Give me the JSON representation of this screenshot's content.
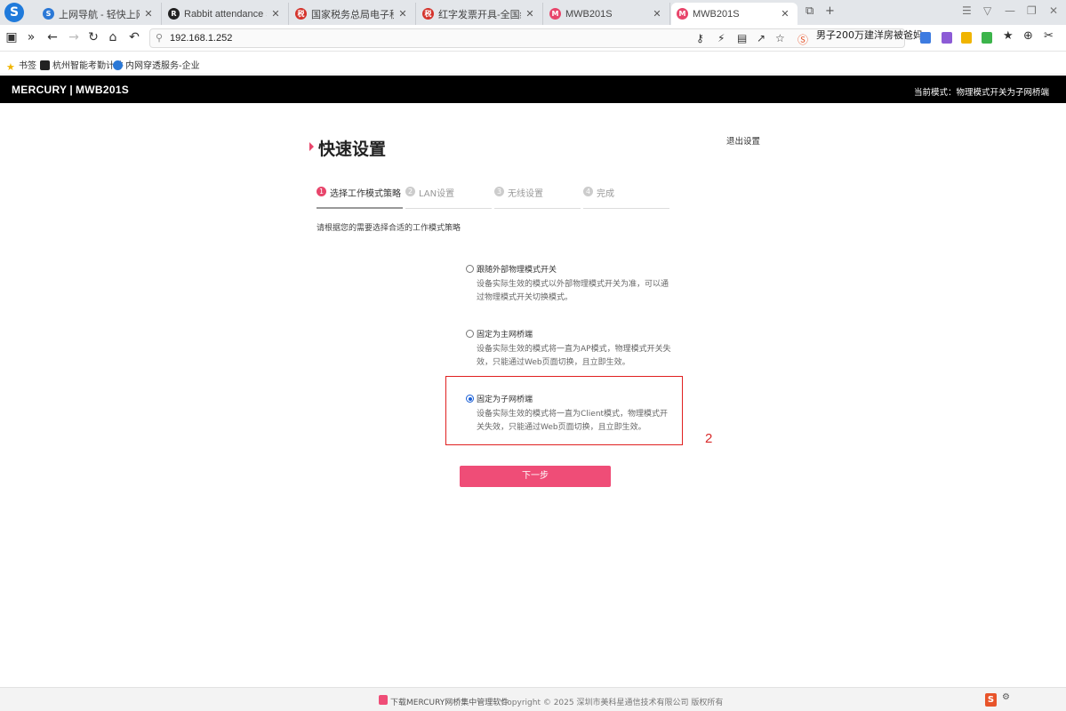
{
  "browser": {
    "tabs": [
      {
        "title": "上网导航 - 轻快上网 从这里开始",
        "favicon": "s-circle-icon",
        "color": "#2b78d6",
        "active": false
      },
      {
        "title": "Rabbit attendance software",
        "favicon": "rabbit-icon",
        "color": "#222222",
        "active": false
      },
      {
        "title": "国家税务总局电子税务局",
        "favicon": "tax-emblem-icon",
        "color": "#d4322b",
        "active": false
      },
      {
        "title": "红字发票开具-全国统一规范电子税务局",
        "favicon": "tax-emblem-icon",
        "color": "#d4322b",
        "active": false
      },
      {
        "title": "MWB201S",
        "favicon": "mercury-m-icon",
        "color": "#e8456b",
        "active": false
      },
      {
        "title": "MWB201S",
        "favicon": "mercury-m-icon",
        "color": "#e8456b",
        "active": true
      }
    ],
    "url": "192.168.1.252",
    "hot_search": "男子200万建洋房被爸妈",
    "bookmarks": [
      {
        "label": "书签",
        "icon": "star-icon"
      },
      {
        "label": "杭州智能考勤计件",
        "icon": "rabbit-icon"
      },
      {
        "label": "内网穿透服务-企业",
        "icon": "globe-icon"
      }
    ]
  },
  "router": {
    "brand": "MERCURY",
    "model": "MWB201S",
    "current_mode": "当前模式：物理模式开关为子网桥端",
    "exit_label": "退出设置",
    "page_title": "快速设置",
    "steps": [
      {
        "num": "1",
        "label": "选择工作模式策略",
        "active": true
      },
      {
        "num": "2",
        "label": "LAN设置",
        "active": false
      },
      {
        "num": "3",
        "label": "无线设置",
        "active": false
      },
      {
        "num": "4",
        "label": "完成",
        "active": false
      }
    ],
    "hint": "请根据您的需要选择合适的工作模式策略",
    "options": [
      {
        "title": "跟随外部物理模式开关",
        "desc": "设备实际生效的模式以外部物理模式开关为准，可以通过物理模式开关切换模式。",
        "selected": false
      },
      {
        "title": "固定为主网桥端",
        "desc": "设备实际生效的模式将一直为AP模式，物理模式开关失效，只能通过Web页面切换，且立即生效。",
        "selected": false
      },
      {
        "title": "固定为子网桥端",
        "desc": "设备实际生效的模式将一直为Client模式，物理模式开关失效，只能通过Web页面切换，且立即生效。",
        "selected": true
      }
    ],
    "next_label": "下一步",
    "annotation_number": "2",
    "footer_download": "下载MERCURY网桥集中管理软件",
    "footer_copyright": "Copyright © 2025 深圳市美科星通信技术有限公司 版权所有"
  },
  "colors": {
    "accent": "#ef4d77",
    "highlight_box": "#e02020",
    "header_bg": "#000000"
  }
}
